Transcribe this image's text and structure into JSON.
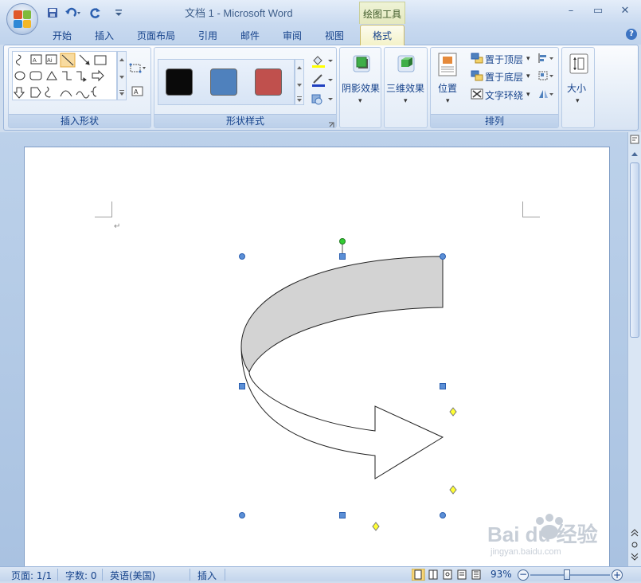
{
  "app": {
    "title": "文档 1 - Microsoft Word",
    "context_tool": "绘图工具"
  },
  "tabs": [
    "开始",
    "插入",
    "页面布局",
    "引用",
    "邮件",
    "审阅",
    "视图"
  ],
  "active_tab": "格式",
  "ribbon": {
    "groups": {
      "insert_shapes": "插入形状",
      "shape_styles": "形状样式",
      "shadow": "阴影效果",
      "threed": "三维效果",
      "arrange": "排列",
      "size": "大小"
    },
    "arrange": {
      "position": "位置",
      "bring_front": "置于顶层",
      "send_back": "置于底层",
      "text_wrap": "文字环绕"
    },
    "style_colors": [
      "#0a0a0a",
      "#4f81bd",
      "#c0504d"
    ]
  },
  "status": {
    "page": "页面: 1/1",
    "words": "字数: 0",
    "language": "英语(美国)",
    "mode": "插入",
    "zoom": "93%"
  },
  "colors": {
    "accent": "#15428b",
    "handle_blue": "#5b8fd6",
    "handle_yellow": "#ffff33",
    "rotate_green": "#33cc33",
    "arrow_fill_top": "#d3d3d3"
  },
  "watermark": {
    "logo": "Bai du 经验",
    "url": "jingyan.baidu.com"
  }
}
